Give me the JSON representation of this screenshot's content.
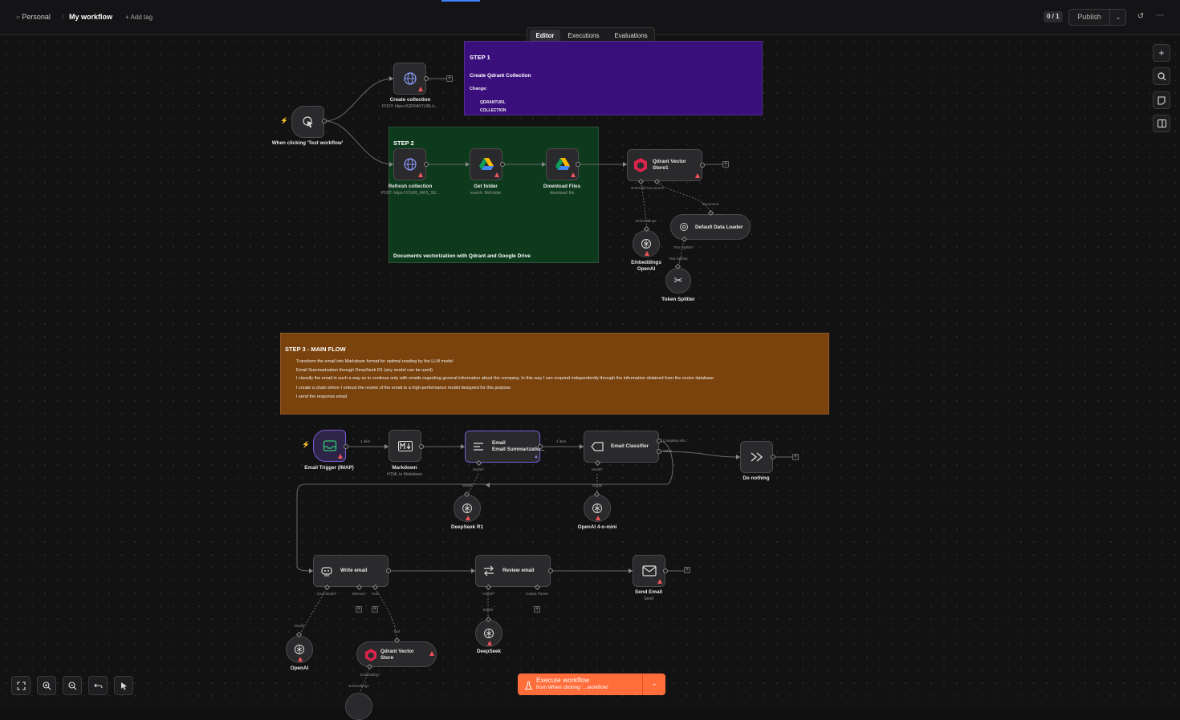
{
  "topbar": {
    "project": "Personal",
    "workflow_name": "My workflow",
    "add_tag": "+ Add tag",
    "version_badge": "0 / 1",
    "publish": "Publish"
  },
  "tabs": [
    {
      "label": "Editor",
      "active": true
    },
    {
      "label": "Executions",
      "active": false
    },
    {
      "label": "Evaluations",
      "active": false
    }
  ],
  "stickies": {
    "step1": {
      "title": "STEP 1",
      "heading": "Create Qdrant Collection",
      "change_label": "Change:",
      "items": [
        "QDRANTURL",
        "COLLECTION"
      ],
      "color": "#3a0f7c"
    },
    "step2": {
      "title": "STEP 2",
      "footer": "Documents vectorization with Qdrant and Google Drive",
      "color": "#0d3a1c"
    },
    "step3": {
      "title": "STEP 3 - MAIN FLOW",
      "lines": [
        "Transform the email into Markdown format for optimal reading by the LLM model",
        "Email Summarization through DeepSeek R1 (any model can be used)",
        "I classify the email in such a way as to continue only with emails regarding general information about the company. In this way I can respond independently through the information obtained from the vector database",
        "I create a chain where I entrust the review of the email to a high-performance model designed for this purpose",
        "I send the response email"
      ],
      "color": "#7a420c"
    }
  },
  "nodes": {
    "manual_trigger": {
      "label": "When clicking 'Test workflow'"
    },
    "create_collection": {
      "label": "Create collection",
      "subtitle": "POST: https://QDRANTURL/c..."
    },
    "refresh_collection": {
      "label": "Refresh collection",
      "subtitle": "POST: https://YOUR_AWS_SE..."
    },
    "get_folder": {
      "label": "Get folder",
      "subtitle": "search: fileFolder"
    },
    "download_files": {
      "label": "Download Files",
      "subtitle": "download: file"
    },
    "qdrant_store1": {
      "label": "Qdrant Vector Store1",
      "ports": [
        "Embeddi Document*"
      ]
    },
    "default_data_loader": {
      "label": "Default Data Loader",
      "ports": [
        "Document",
        "Text Splitter*"
      ]
    },
    "embeddings_openai": {
      "label": "Embeddings OpenAI",
      "ports": [
        "Embeddings"
      ]
    },
    "token_splitter": {
      "label": "Token Splitter",
      "ports": [
        "Text Splitter"
      ]
    },
    "email_trigger": {
      "label": "Email Trigger (IMAP)"
    },
    "markdown": {
      "label": "Markdown",
      "subtitle": "HTML to Markdown"
    },
    "email_summarization": {
      "label": "Email Summarizatio...",
      "ports": [
        "Model*",
        "Model"
      ]
    },
    "email_classifier": {
      "label": "Email Classifier",
      "ports": [
        "Model*",
        "Model"
      ],
      "outputs": [
        "Company info ...",
        "Other"
      ]
    },
    "do_nothing": {
      "label": "Do nothing"
    },
    "deepseek_r1": {
      "label": "DeepSeek R1"
    },
    "openai_4o_mini": {
      "label": "OpenAI 4-o-mini"
    },
    "write_email": {
      "label": "Write email",
      "ports": [
        "Chat Model*",
        "Memory",
        "Tool"
      ]
    },
    "review_email": {
      "label": "Review email",
      "ports": [
        "Model*",
        "Output Parser",
        "Model"
      ]
    },
    "send_email": {
      "label": "Send Email",
      "subtitle": "Send"
    },
    "openai": {
      "label": "OpenAI",
      "ports": [
        "Model"
      ]
    },
    "qdrant_store": {
      "label": "Qdrant Vector Store",
      "ports": [
        "Tool",
        "Embedding*",
        "Embeddings"
      ]
    },
    "deepseek": {
      "label": "DeepSeek"
    }
  },
  "edge_labels": [
    "1 item",
    "1 item"
  ],
  "execute": {
    "title": "Execute workflow",
    "subtitle": "from When clicking '...workflow'"
  },
  "icons": [
    "user-icon",
    "history-icon",
    "more-icon",
    "plus-icon",
    "search-icon",
    "sticky-note-icon",
    "panel-icon",
    "fit-view-icon",
    "zoom-in-icon",
    "zoom-out-icon",
    "undo-icon",
    "cursor-icon",
    "flask-icon",
    "chevron-down-icon"
  ],
  "colors": {
    "accent": "#ff6d3a",
    "warning": "#f2545b",
    "selected": "#7a5cd6"
  }
}
